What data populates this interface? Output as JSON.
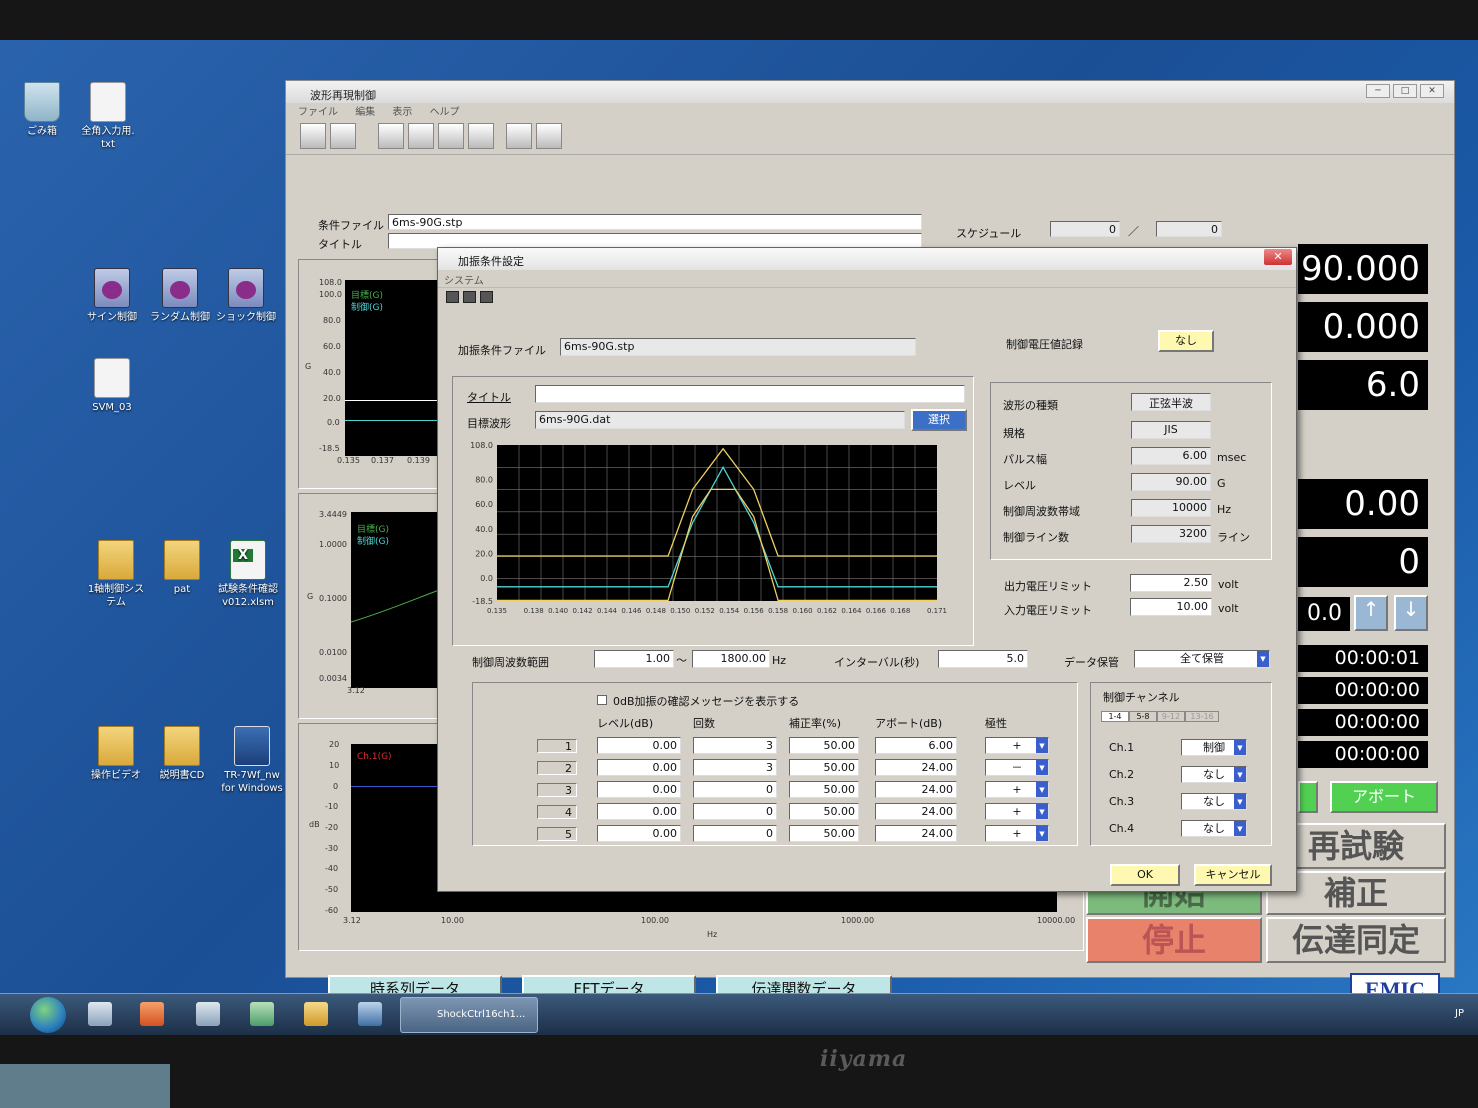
{
  "monitor": {
    "brand": "iiyama"
  },
  "desktop": {
    "icons": [
      {
        "name": "recycle-bin",
        "label": "ごみ箱"
      },
      {
        "name": "text-file",
        "label": "全角入力用.\ntxt"
      },
      {
        "name": "sine-control",
        "label": "サイン制御"
      },
      {
        "name": "random-control",
        "label": "ランダム制御"
      },
      {
        "name": "shock-control",
        "label": "ショック制御"
      },
      {
        "name": "svm-file",
        "label": "SVM_03"
      },
      {
        "name": "folder-1axis",
        "label": "1軸制御シス\nテム"
      },
      {
        "name": "folder-pat",
        "label": "pat"
      },
      {
        "name": "excel-file",
        "label": "試験条件確認\nv012.xlsm"
      },
      {
        "name": "folder-video",
        "label": "操作ビデオ"
      },
      {
        "name": "folder-manual",
        "label": "説明書CD"
      },
      {
        "name": "tr-app",
        "label": "TR-7Wf_nw\nfor Windows"
      }
    ]
  },
  "taskbar": {
    "task_label": "ShockCtrl16ch1...",
    "tray": "JP"
  },
  "main": {
    "title": "波形再現制御",
    "menu": [
      "ファイル",
      "編集",
      "表示",
      "ヘルプ"
    ],
    "condition_file_label": "条件ファイル",
    "condition_file": "6ms-90G.stp",
    "title_label": "タイトル",
    "title_value": "",
    "schedule_label": "スケジュール",
    "schedule_a": "0",
    "schedule_sep": "／",
    "schedule_b": "0",
    "values": [
      "90.000",
      "0.000",
      "6.0",
      "0.00",
      "0"
    ],
    "step_value": "0.0",
    "times": [
      "00:00:01",
      "00:00:00",
      "00:00:00",
      "00:00:00"
    ],
    "abort_label": "アボート",
    "retest_label": "再試験",
    "correct_label": "補正",
    "start_label": "開始",
    "stop_label": "停止",
    "transfer_label": "伝達同定",
    "ts_button": "時系列データ",
    "fft_button": "FFTデータ",
    "tf_button": "伝達関数データ",
    "logo": "EMIC",
    "plot1": {
      "legend": [
        "目標(G)",
        "制御(G)"
      ],
      "y_ticks": [
        "108.0",
        "100.0",
        "80.0",
        "60.0",
        "40.0",
        "20.0",
        "0.0",
        "-18.5"
      ],
      "x_ticks": [
        "0.135",
        "0.137",
        "0.139"
      ],
      "ylabel": "G"
    },
    "plot2": {
      "legend": [
        "目標(G)",
        "制御(G)"
      ],
      "y_ticks": [
        "3.4449",
        "1.0000",
        "0.1000",
        "0.0100",
        "0.0034"
      ],
      "x_ticks": [
        "3.12"
      ],
      "ylabel": "G"
    },
    "plot3": {
      "legend": [
        "Ch.1(G)"
      ],
      "y_ticks": [
        "20",
        "10",
        "0",
        "-10",
        "-20",
        "-30",
        "-40",
        "-50",
        "-60"
      ],
      "x_ticks": [
        "3.12",
        "10.00",
        "100.00",
        "1000.00",
        "10000.00"
      ],
      "xlabel": "Hz",
      "ylabel": "dB"
    }
  },
  "dialog": {
    "title": "加振条件設定",
    "menu": "システム",
    "file_label": "加振条件ファイル",
    "file_value": "6ms-90G.stp",
    "voltage_record_label": "制御電圧値記録",
    "voltage_record_value": "なし",
    "title_label": "タイトル",
    "title_value": "",
    "target_label": "目標波形",
    "target_value": "6ms-90G.dat",
    "select_label": "選択",
    "wave_type_label": "波形の種類",
    "wave_type_value": "正弦半波",
    "standard_label": "規格",
    "standard_value": "JIS",
    "pulse_label": "パルス幅",
    "pulse_value": "6.00",
    "pulse_unit": "msec",
    "level_label": "レベル",
    "level_value": "90.00",
    "level_unit": "G",
    "band_label": "制御周波数帯域",
    "band_value": "10000",
    "band_unit": "Hz",
    "lines_label": "制御ライン数",
    "lines_value": "3200",
    "lines_unit": "ライン",
    "out_limit_label": "出力電圧リミット",
    "out_limit_value": "2.50",
    "out_limit_unit": "volt",
    "in_limit_label": "入力電圧リミット",
    "in_limit_value": "10.00",
    "in_limit_unit": "volt",
    "freq_range_label": "制御周波数範囲",
    "freq_min": "1.00",
    "freq_sep": "～",
    "freq_max": "1800.00",
    "freq_unit": "Hz",
    "interval_label": "インターバル(秒)",
    "interval_value": "5.0",
    "save_label": "データ保管",
    "save_value": "全て保管",
    "confirm_label": "0dB加振の確認メッセージを表示する",
    "table_headers": [
      "レベル(dB)",
      "回数",
      "補正率(%)",
      "アボート(dB)",
      "極性"
    ],
    "rows": [
      {
        "n": "1",
        "level": "0.00",
        "count": "3",
        "rate": "50.00",
        "abort": "6.00",
        "polarity": "+"
      },
      {
        "n": "2",
        "level": "0.00",
        "count": "3",
        "rate": "50.00",
        "abort": "24.00",
        "polarity": "－"
      },
      {
        "n": "3",
        "level": "0.00",
        "count": "0",
        "rate": "50.00",
        "abort": "24.00",
        "polarity": "+"
      },
      {
        "n": "4",
        "level": "0.00",
        "count": "0",
        "rate": "50.00",
        "abort": "24.00",
        "polarity": "+"
      },
      {
        "n": "5",
        "level": "0.00",
        "count": "0",
        "rate": "50.00",
        "abort": "24.00",
        "polarity": "+"
      }
    ],
    "channel_label": "制御チャンネル",
    "channel_tabs": [
      "1-4",
      "5-8",
      "9-12",
      "13-16"
    ],
    "channels": [
      {
        "name": "Ch.1",
        "value": "制御"
      },
      {
        "name": "Ch.2",
        "value": "なし"
      },
      {
        "name": "Ch.3",
        "value": "なし"
      },
      {
        "name": "Ch.4",
        "value": "なし"
      }
    ],
    "ok_label": "OK",
    "cancel_label": "キャンセル",
    "chart": {
      "y_ticks": [
        "108.0",
        "80.0",
        "60.0",
        "40.0",
        "20.0",
        "0.0",
        "-18.5"
      ],
      "x_ticks": [
        "0.135",
        "0.138",
        "0.140",
        "0.142",
        "0.144",
        "0.146",
        "0.148",
        "0.150",
        "0.152",
        "0.154",
        "0.156",
        "0.158",
        "0.160",
        "0.162",
        "0.164",
        "0.166",
        "0.168",
        "0.171"
      ]
    }
  },
  "chart_data": {
    "type": "line",
    "xlim": [
      0.135,
      0.171
    ],
    "ylim": [
      -18.5,
      108.0
    ],
    "series": [
      {
        "color": "#f0d060",
        "x": [
          0.135,
          0.149,
          0.151,
          0.1535,
          0.156,
          0.158,
          0.171
        ],
        "y": [
          18,
          18,
          72,
          105,
          72,
          18,
          18
        ]
      },
      {
        "color": "#4fd4d4",
        "x": [
          0.135,
          0.149,
          0.151,
          0.1535,
          0.156,
          0.158,
          0.171
        ],
        "y": [
          -7,
          -7,
          45,
          90,
          45,
          -7,
          -7
        ]
      },
      {
        "color": "#f0d060",
        "x": [
          0.135,
          0.149,
          0.151,
          0.1525,
          0.1545,
          0.156,
          0.158,
          0.171
        ],
        "y": [
          -18,
          -18,
          50,
          72,
          72,
          50,
          -18,
          -18
        ]
      }
    ]
  }
}
